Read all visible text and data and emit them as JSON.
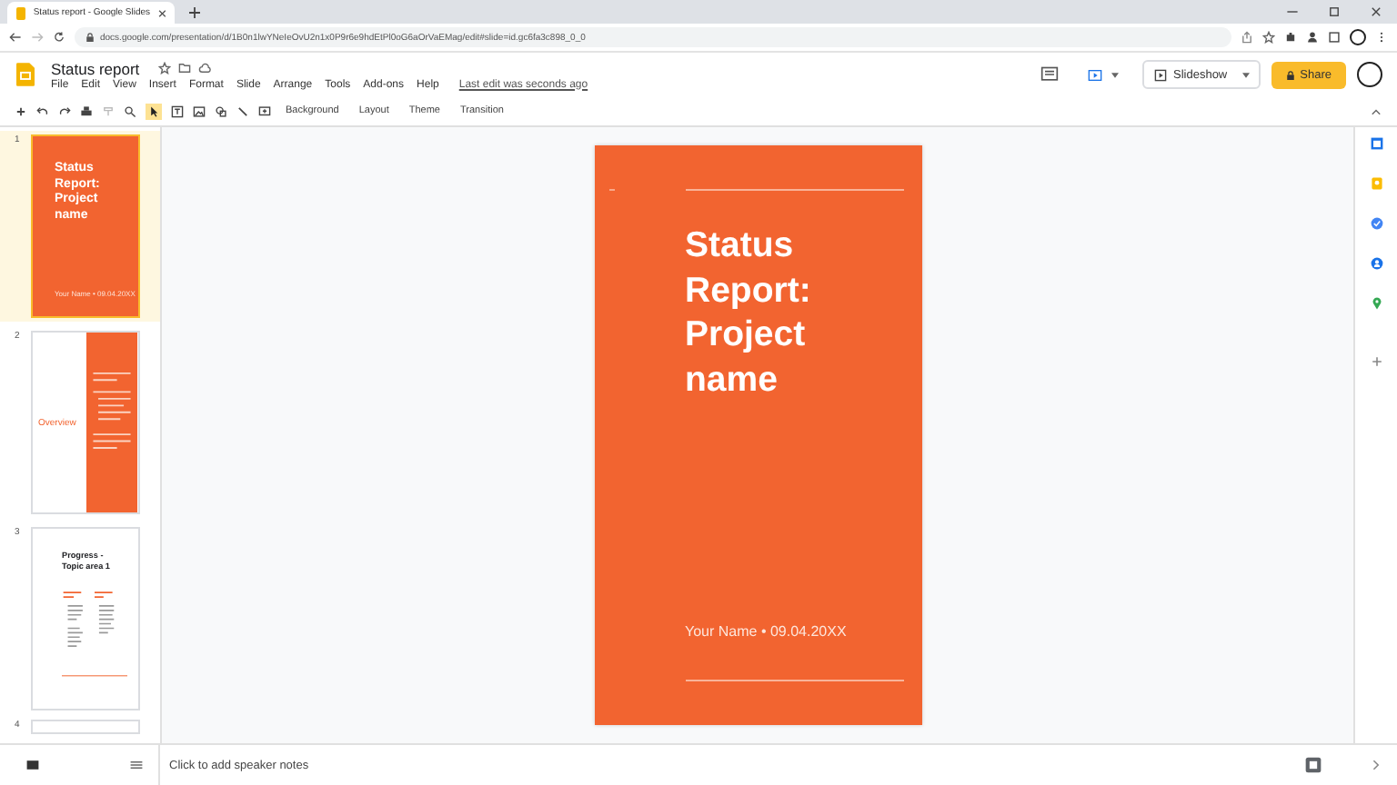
{
  "browser": {
    "tab_title": "Status report - Google Slides",
    "url": "docs.google.com/presentation/d/1B0n1lwYNeIeOvU2n1x0P9r6e9hdEtPl0oG6aOrVaEMag/edit#slide=id.gc6fa3c898_0_0"
  },
  "document": {
    "title": "Status report",
    "menu": [
      "File",
      "Edit",
      "View",
      "Insert",
      "Format",
      "Slide",
      "Arrange",
      "Tools",
      "Add-ons",
      "Help"
    ],
    "last_edit": "Last edit was seconds ago",
    "slideshow": "Slideshow",
    "share": "Share"
  },
  "toolbar": {
    "buttons": [
      "Background",
      "Layout",
      "Theme",
      "Transition"
    ]
  },
  "filmstrip": [
    {
      "number": "1",
      "selected": true,
      "kind": "title",
      "title": "Status Report: Project name",
      "subtitle": "Your Name • 09.04.20XX"
    },
    {
      "number": "2",
      "selected": false,
      "kind": "overview",
      "heading": "Overview"
    },
    {
      "number": "3",
      "selected": false,
      "kind": "progress",
      "heading": "Progress - Topic area 1"
    },
    {
      "number": "4",
      "selected": false,
      "kind": "cut"
    }
  ],
  "slide": {
    "title": "Status Report: Project name",
    "subtitle": "Your Name • 09.04.20XX"
  },
  "notes": {
    "placeholder": "Click to add speaker notes"
  }
}
